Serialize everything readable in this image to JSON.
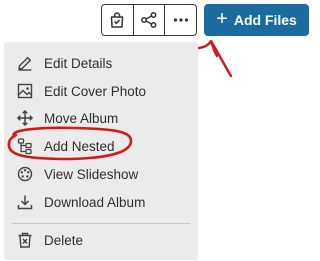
{
  "toolbar": {
    "icons": [
      "shopping-bag-icon",
      "share-icon",
      "more-options-icon"
    ],
    "add_files_label": "Add Files",
    "accent_color": "#1b6aa0"
  },
  "menu": {
    "items": [
      {
        "label": "Edit Details",
        "icon": "pencil-icon"
      },
      {
        "label": "Edit Cover Photo",
        "icon": "image-icon"
      },
      {
        "label": "Move Album",
        "icon": "move-arrows-icon"
      },
      {
        "label": "Add Nested",
        "icon": "nested-tree-icon"
      },
      {
        "label": "View Slideshow",
        "icon": "slideshow-icon"
      },
      {
        "label": "Download Album",
        "icon": "download-icon"
      },
      {
        "label": "Delete",
        "icon": "trash-icon"
      }
    ]
  },
  "annotation_color": "#d11a1a"
}
